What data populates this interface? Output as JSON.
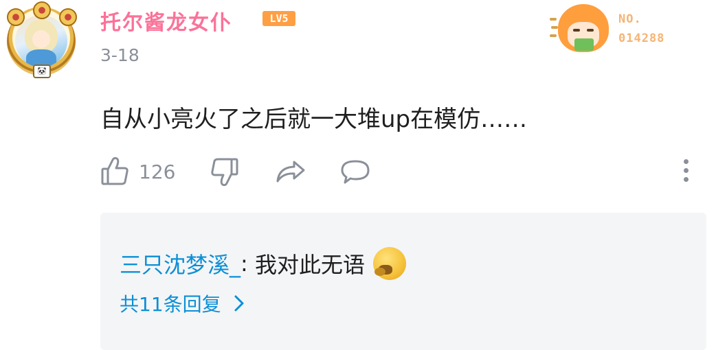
{
  "comment": {
    "user": {
      "name": "托尔酱龙女仆",
      "level": "LV5",
      "date": "3-18",
      "avatar_badge": "🐼",
      "fan_badge": {
        "line1": "NO.",
        "line2": "014288"
      }
    },
    "text": "自从小亮火了之后就一大堆up在模仿……",
    "actions": {
      "like_icon": "thumbs-up-icon",
      "like_count": "126",
      "dislike_icon": "thumbs-down-icon",
      "share_icon": "share-icon",
      "reply_icon": "reply-bubble-icon",
      "more_icon": "more-vertical-icon"
    },
    "replies": {
      "preview_user": "三只沈梦溪_",
      "preview_separator": ": ",
      "preview_text": "我对此无语",
      "preview_emoji": "speechless-emoji",
      "more_label": "共11条回复",
      "more_icon": "chevron-right-icon"
    }
  },
  "colors": {
    "username": "#fb7299",
    "level_badge": "#ff9f43",
    "meta": "#8a8f99",
    "reply_link": "#0b8fd6",
    "reply_bg": "#f4f5f7"
  }
}
